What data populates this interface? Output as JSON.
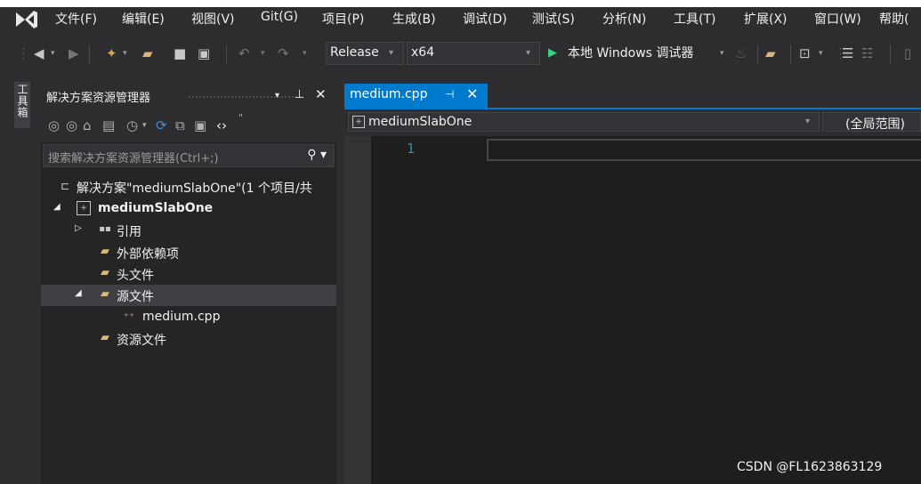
{
  "menubar": {
    "items": [
      "文件(F)",
      "编辑(E)",
      "视图(V)",
      "Git(G)",
      "项目(P)",
      "生成(B)",
      "调试(D)",
      "测试(S)",
      "分析(N)",
      "工具(T)",
      "扩展(X)",
      "窗口(W)",
      "帮助("
    ]
  },
  "toolbar": {
    "configuration": "Release",
    "platform": "x64",
    "run_label": "本地 Windows 调试器"
  },
  "toolbox_rail": {
    "label": "工具箱"
  },
  "solution_explorer": {
    "title": "解决方案资源管理器",
    "pin": "ꟸ",
    "search_placeholder": "搜索解决方案资源管理器(Ctrl+;)",
    "tree": [
      {
        "label": "解决方案\"mediumSlabOne\"(1 个项目/共",
        "icon": "solution-icon"
      },
      {
        "label": "mediumSlabOne",
        "icon": "project-icon"
      },
      {
        "label": "引用",
        "icon": "references-icon"
      },
      {
        "label": "外部依赖项",
        "icon": "external-deps-icon"
      },
      {
        "label": "头文件",
        "icon": "filter-folder-icon"
      },
      {
        "label": "源文件",
        "icon": "filter-folder-icon"
      },
      {
        "label": "medium.cpp",
        "icon": "cpp-file-icon"
      },
      {
        "label": "资源文件",
        "icon": "filter-folder-icon"
      }
    ]
  },
  "editor": {
    "tab_label": "medium.cpp",
    "nav_project": "mediumSlabOne",
    "nav_scope": "(全局范围)",
    "line_number": "1"
  },
  "watermark": "CSDN @FL1623863129",
  "colors": {
    "accent": "#007acc",
    "background": "#2d2d30",
    "editor_bg": "#1e1e1e",
    "line_number": "#2b91af",
    "vs_purple": "#8e5bd3"
  }
}
